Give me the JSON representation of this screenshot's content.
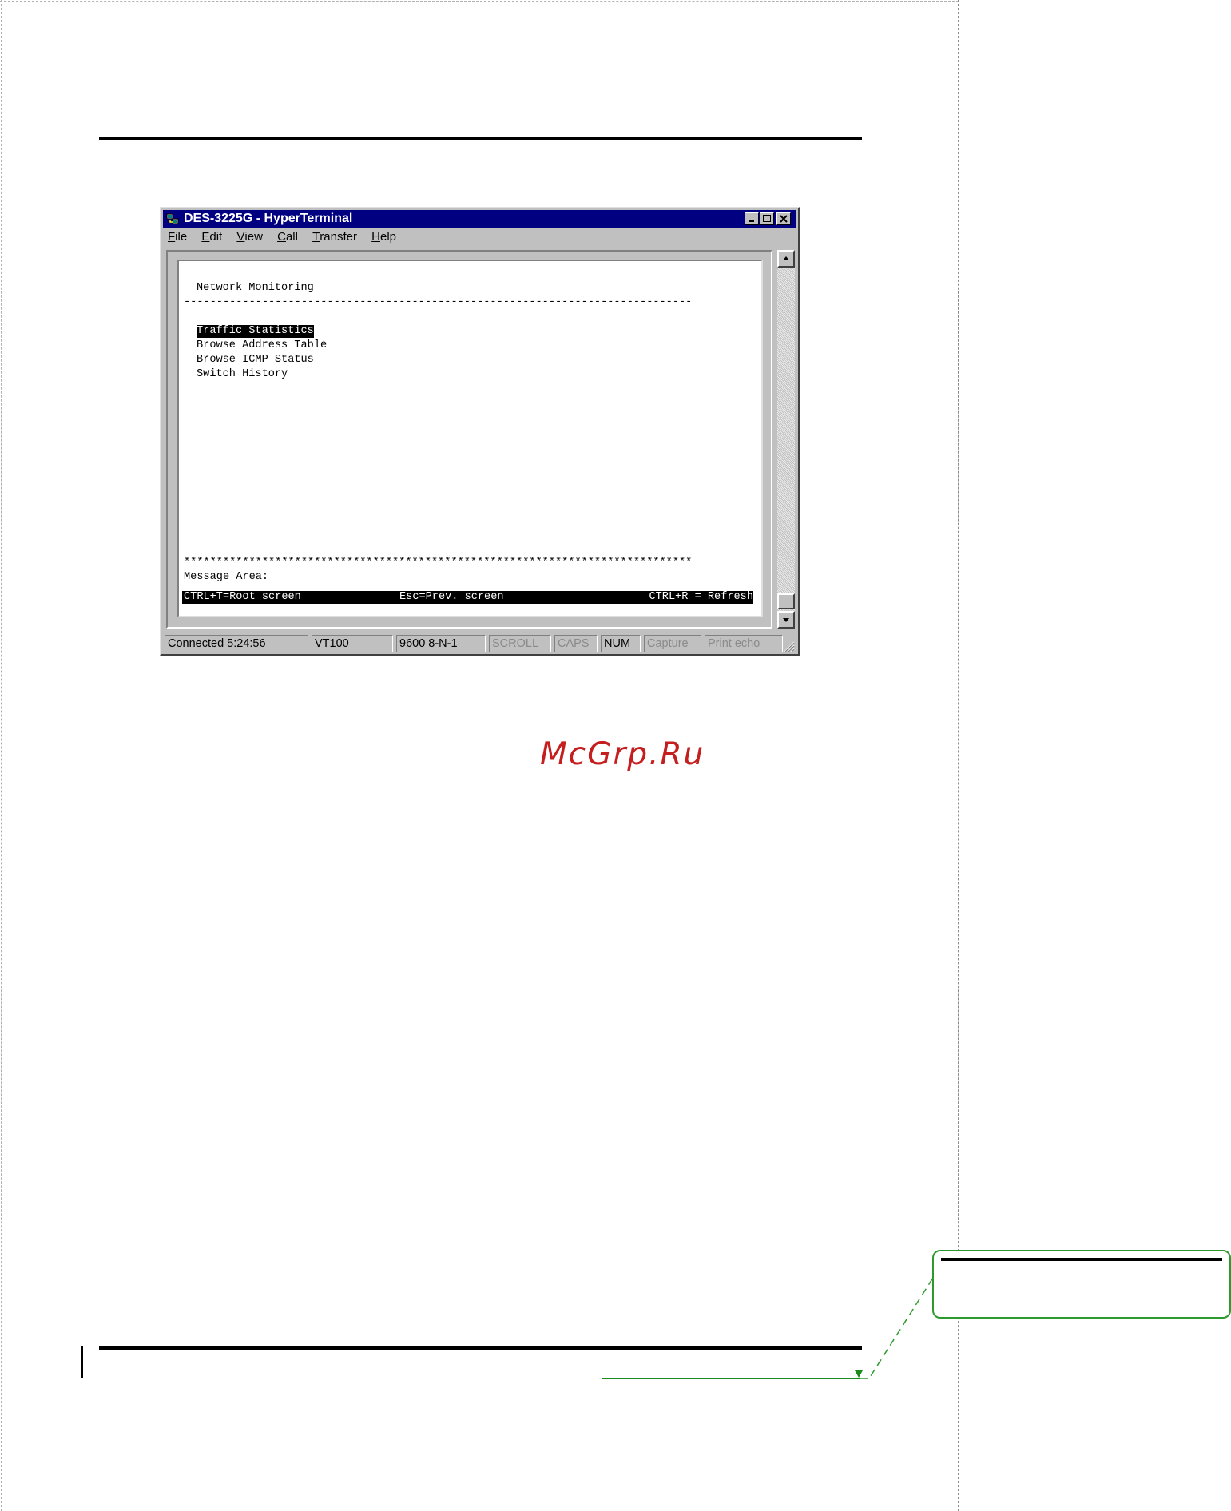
{
  "window": {
    "title": "DES-3225G - HyperTerminal",
    "menu": [
      {
        "label": "File",
        "accel": "F",
        "rest": "ile"
      },
      {
        "label": "Edit",
        "accel": "E",
        "rest": "dit"
      },
      {
        "label": "View",
        "accel": "V",
        "rest": "iew"
      },
      {
        "label": "Call",
        "accel": "C",
        "rest": "all"
      },
      {
        "label": "Transfer",
        "accel": "T",
        "rest": "ransfer"
      },
      {
        "label": "Help",
        "accel": "H",
        "rest": "elp"
      }
    ]
  },
  "terminal": {
    "heading": "Network Monitoring",
    "divider": "------------------------------------------------------------------------------",
    "menu_items": [
      "Traffic Statistics",
      "Browse Address Table",
      "Browse ICMP Status",
      "Switch History"
    ],
    "selected_index": 0,
    "stars": "******************************************************************************",
    "message_area": "Message Area:",
    "hint_root": "CTRL+T=Root screen",
    "hint_prev": "Esc=Prev. screen",
    "hint_refresh": "CTRL+R = Refresh"
  },
  "statusbar": {
    "connected": "Connected 5:24:56",
    "emulation": "VT100",
    "settings": "9600 8-N-1",
    "scroll": "SCROLL",
    "caps": "CAPS",
    "num": "NUM",
    "capture": "Capture",
    "print_echo": "Print echo"
  },
  "watermark": "McGrp.Ru",
  "colors": {
    "titlebar": "#000080",
    "watermark": "#c41e1e",
    "comment_border": "#2e9a2e"
  }
}
